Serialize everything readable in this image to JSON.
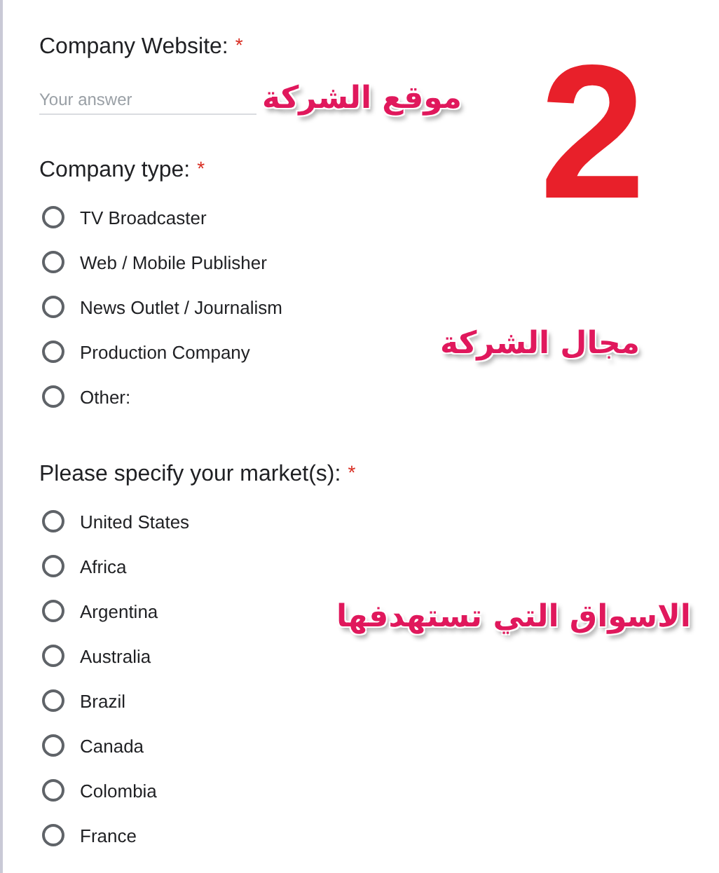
{
  "questions": [
    {
      "kind": "text",
      "title": "Company Website:",
      "required_mark": "*",
      "placeholder": "Your answer"
    },
    {
      "kind": "radio",
      "title": "Company type:",
      "required_mark": "*",
      "options": [
        {
          "label": "TV Broadcaster",
          "selected": false
        },
        {
          "label": "Web / Mobile Publisher",
          "selected": false
        },
        {
          "label": "News Outlet / Journalism",
          "selected": false
        },
        {
          "label": "Production Company",
          "selected": false
        },
        {
          "label": "Other:",
          "selected": false
        }
      ]
    },
    {
      "kind": "radio",
      "title": "Please specify your market(s):",
      "required_mark": "*",
      "options": [
        {
          "label": "United States",
          "selected": false
        },
        {
          "label": "Africa",
          "selected": false
        },
        {
          "label": "Argentina",
          "selected": false
        },
        {
          "label": "Australia",
          "selected": false
        },
        {
          "label": "Brazil",
          "selected": false
        },
        {
          "label": "Canada",
          "selected": false
        },
        {
          "label": "Colombia",
          "selected": false
        },
        {
          "label": "France",
          "selected": false
        }
      ]
    }
  ],
  "annotations": [
    {
      "kind": "label",
      "text": "موقع الشركة"
    },
    {
      "kind": "number",
      "text": "2"
    },
    {
      "kind": "label",
      "text": "مجال الشركة"
    },
    {
      "kind": "label",
      "text": "الاسواق التي تستهدفها"
    }
  ]
}
